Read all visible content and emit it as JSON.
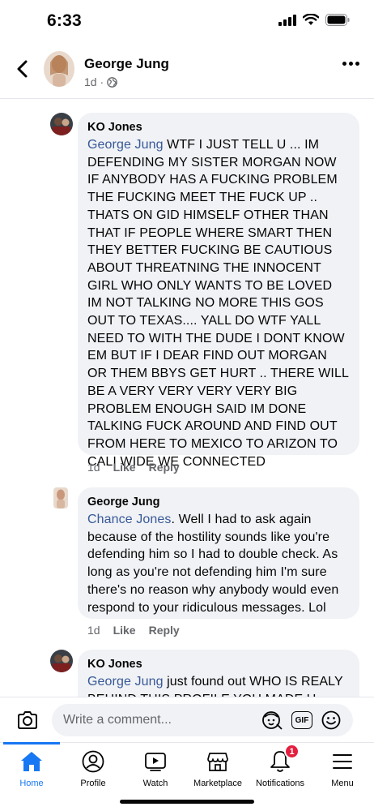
{
  "status_bar": {
    "time": "6:33"
  },
  "header": {
    "name": "George Jung",
    "meta": "1d ·"
  },
  "comments": [
    {
      "author": "KO Jones",
      "mention": "George Jung",
      "text": " WTF I JUST TELL U ... IM DEFENDING MY SISTER MORGAN NOW IF ANYBODY HAS A FUCKING PROBLEM THE FUCKING MEET THE FUCK UP .. THATS ON GID HIMSELF OTHER THAN THAT IF PEOPLE WHERE SMART THEN THEY BETTER FUCKING  BE CAUTIOUS ABOUT THREATNING THE INNOCENT GIRL WHO ONLY WANTS TO BE LOVED IM NOT TALKING NO MORE THIS GOS OUT TO TEXAS.... YALL DO WTF YALL NEED TO WITH THE DUDE I DONT KNOW EM BUT IF I DEAR FIND OUT MORGAN OR THEM BBYS GET HURT .. THERE WILL BE A VERY VERY VERY VERY BIG PROBLEM ENOUGH SAID IM DONE TALKING FUCK AROUND AND FIND OUT FROM HERE TO MEXICO TO ARIZON TO CALI WIDE WE CONNECTED",
      "time": "1d",
      "like": "Like",
      "reply": "Reply"
    },
    {
      "author": "George Jung",
      "mention": "Chance Jones",
      "text": ". Well I had to ask again because of the hostility sounds like you're defending him so I had to double check. As long as you're not defending him I'm sure there's no reason why anybody would even respond to your ridiculous messages. Lol",
      "time": "1d",
      "like": "Like",
      "reply": "Reply"
    },
    {
      "author": "KO Jones",
      "mention": "George Jung",
      "text": " just found out WHO IS REALY BEHIND THIS PROFILE YOU MADE U"
    }
  ],
  "composer": {
    "placeholder": "Write a comment...",
    "gif_label": "GIF"
  },
  "tabs": [
    {
      "label": "Home",
      "icon": "home-icon",
      "active": true
    },
    {
      "label": "Profile",
      "icon": "profile-icon"
    },
    {
      "label": "Watch",
      "icon": "watch-icon"
    },
    {
      "label": "Marketplace",
      "icon": "marketplace-icon"
    },
    {
      "label": "Notifications",
      "icon": "bell-icon",
      "badge": "1"
    },
    {
      "label": "Menu",
      "icon": "menu-icon"
    }
  ],
  "colors": {
    "accent": "#1877f2",
    "mention": "#385898",
    "bubble": "#f0f2f5",
    "badge": "#e41e3f"
  }
}
